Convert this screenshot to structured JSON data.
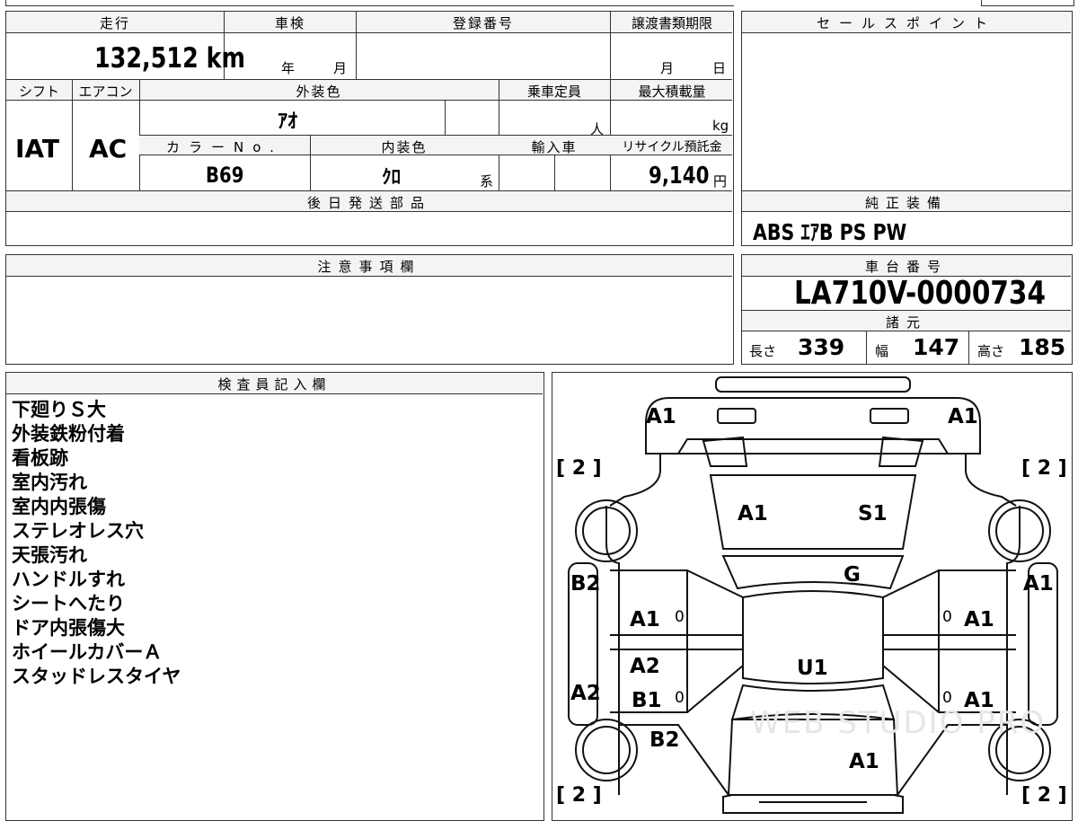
{
  "mileage": {
    "label": "走行",
    "value": "132,512 km"
  },
  "inspection": {
    "label": "車検",
    "year_unit": "年",
    "month_unit": "月"
  },
  "registration": {
    "label": "登録番号"
  },
  "transfer_deadline": {
    "label": "譲渡書類期限",
    "month_unit": "月",
    "day_unit": "日"
  },
  "sales_point": {
    "label": "セールスポイント"
  },
  "shift": {
    "label": "シフト",
    "value": "IAT"
  },
  "aircon": {
    "label": "エアコン",
    "value": "AC"
  },
  "exterior_color": {
    "label": "外装色",
    "value": "ｱｵ"
  },
  "capacity": {
    "label": "乗車定員",
    "unit": "人"
  },
  "max_load": {
    "label": "最大積載量",
    "unit": "kg"
  },
  "color_no": {
    "label": "カラーNo.",
    "value": "B69"
  },
  "interior_color": {
    "label": "内装色",
    "value": "ｸﾛ",
    "suffix": "系"
  },
  "import": {
    "label": "輸入車"
  },
  "recycle_fee": {
    "label": "リサイクル預託金",
    "value": "9,140",
    "unit": "円"
  },
  "later_parts": {
    "label": "後日発送部品"
  },
  "genuine_equipment": {
    "label": "純正装備",
    "value": "ABS ｴｱB PS PW"
  },
  "remarks": {
    "label": "注意事項欄"
  },
  "chassis_no": {
    "label": "車台番号",
    "value": "LA710V-0000734"
  },
  "specs": {
    "label": "諸元",
    "length_label": "長さ",
    "length": "339",
    "width_label": "幅",
    "width": "147",
    "height_label": "高さ",
    "height": "185"
  },
  "inspector": {
    "label": "検査員記入欄",
    "notes": [
      "下廻りＳ大",
      "外装鉄粉付着",
      "看板跡",
      "室内汚れ",
      "室内内張傷",
      "ステレオレス穴",
      "天張汚れ",
      "ハンドルすれ",
      "シートへたり",
      "ドア内張傷大",
      "ホイールカバーＡ",
      "スタッドレスタイヤ"
    ]
  },
  "diagram": {
    "tire_tl": "[ 2 ]",
    "tire_tr": "[ 2 ]",
    "tire_bl": "[ 2 ]",
    "tire_br": "[ 2 ]",
    "front_left": "A1",
    "front_right": "A1",
    "hood_left": "A1",
    "hood_right": "S1",
    "windshield": "G",
    "left_front_fender": "B2",
    "right_front_fender": "A1",
    "left_front_door": "A1",
    "right_front_door": "A1",
    "left_rear_door_top": "A2",
    "left_rear_door": "B1",
    "right_rear_door": "A1",
    "left_rear_fender": "A2",
    "left_rear_quarter": "B2",
    "roof": "U1",
    "rear_body": "A1",
    "zero_l1": "0",
    "zero_l2": "0",
    "zero_r1": "0",
    "zero_r2": "0",
    "watermark": "WEB STUDIO PRO"
  }
}
